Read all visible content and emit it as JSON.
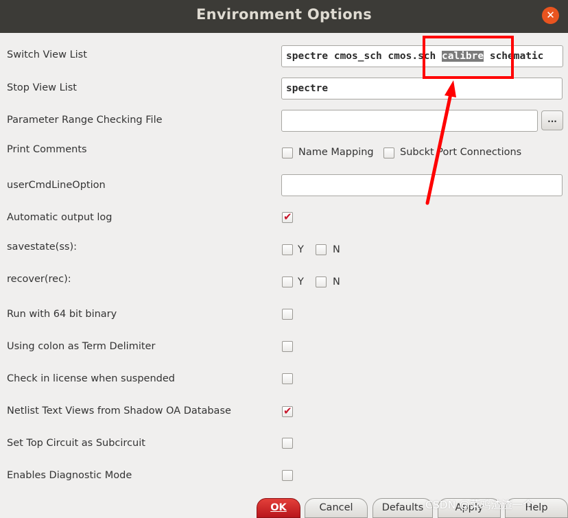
{
  "window": {
    "title": "Environment Options",
    "close_glyph": "✕"
  },
  "form": {
    "switch_view_list": {
      "label": "Switch View List",
      "tokens": [
        "spectre",
        "cmos_sch",
        "cmos.sch"
      ],
      "highlighted": "calibre",
      "after": "schematic"
    },
    "stop_view_list": {
      "label": "Stop View List",
      "value": "spectre"
    },
    "param_range_file": {
      "label": "Parameter Range Checking File",
      "value": "",
      "browse_label": "..."
    },
    "print_comments": {
      "label": "Print Comments",
      "options": [
        {
          "label": "Name Mapping",
          "checked": false
        },
        {
          "label": "Subckt Port Connections",
          "checked": false
        }
      ]
    },
    "user_cmd_line_option": {
      "label": "userCmdLineOption",
      "value": ""
    },
    "auto_output_log": {
      "label": "Automatic output log",
      "checked": true
    },
    "savestate": {
      "label": "savestate(ss):",
      "y_label": "Y",
      "n_label": "N",
      "y": false,
      "n": false
    },
    "recover": {
      "label": "recover(rec):",
      "y_label": "Y",
      "n_label": "N",
      "y": false,
      "n": false
    },
    "run_64bit": {
      "label": "Run with 64 bit binary",
      "checked": false
    },
    "colon_delimiter": {
      "label": "Using colon as Term Delimiter",
      "checked": false
    },
    "checkin_license": {
      "label": "Check in license when suspended",
      "checked": false
    },
    "netlist_text_views": {
      "label": "Netlist Text Views from Shadow OA Database",
      "checked": true
    },
    "top_as_subckt": {
      "label": "Set Top Circuit as Subcircuit",
      "checked": false
    },
    "diagnostic_mode": {
      "label": "Enables Diagnostic Mode",
      "checked": false
    }
  },
  "buttons": {
    "ok": "OK",
    "cancel": "Cancel",
    "defaults": "Defaults",
    "apply": "Apply",
    "help": "Help"
  },
  "checkmark_glyph": "✔",
  "watermark": "CSDN @菜鸡渣渣一个",
  "colors": {
    "titlebar": "#3c3b37",
    "accent_red": "#c7162b",
    "annotation": "#ff0000",
    "close_orange": "#e9541f"
  }
}
